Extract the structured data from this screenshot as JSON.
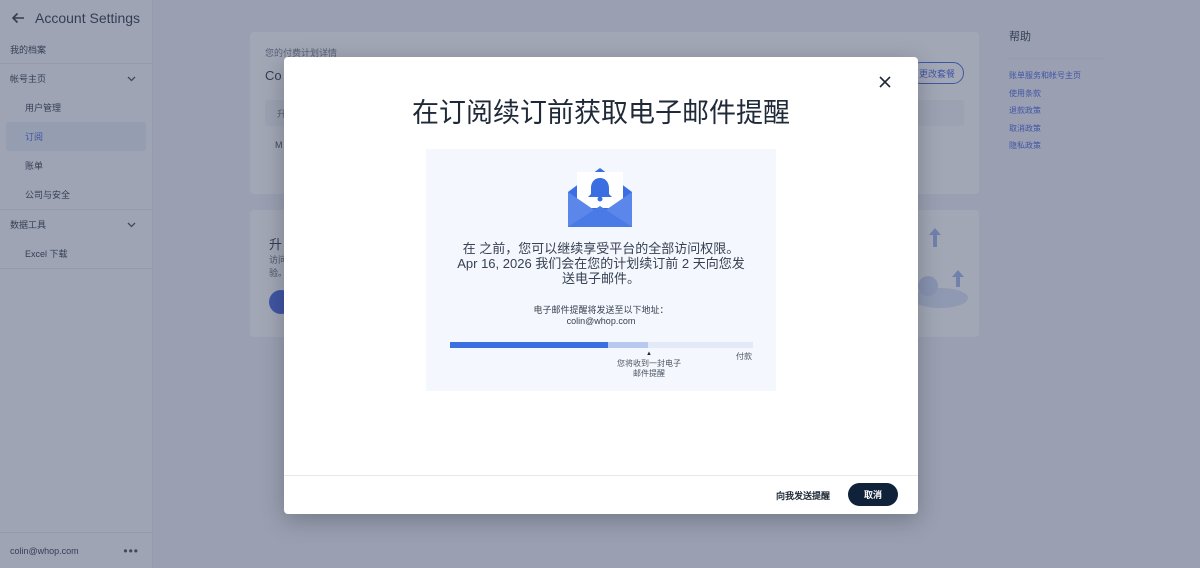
{
  "app": {
    "title": "Account Settings"
  },
  "sidebar": {
    "profile": "我的档案",
    "account_group": "帐号主页",
    "account_items": [
      "用户管理",
      "订阅",
      "账单",
      "公司与安全"
    ],
    "data_group": "数据工具",
    "data_items": [
      "Excel 下载"
    ],
    "user_email": "colin@whop.com"
  },
  "main": {
    "card1_label": "您的付费计划详情",
    "card1_plan": "Co",
    "card1_button": "更改套餐",
    "card1_row": "升",
    "card1_cell": "M",
    "card2_title": "升",
    "card2_text_line1": "访问",
    "card2_text_line2": "验。"
  },
  "help": {
    "title": "帮助",
    "links": [
      "账单服务和帐号主页",
      "使用条款",
      "退款政策",
      "取消政策",
      "隐私政策"
    ]
  },
  "modal": {
    "title": "在订阅续订前获取电子邮件提醒",
    "body_line1": "在 之前，您可以继续享受平台的全部访问权限。",
    "body_line2": "Apr 16, 2026 我们会在您的计划续订前 2 天向您发",
    "body_line3": "送电子邮件。",
    "email_label": "电子邮件提醒将发送至以下地址：",
    "email_value": "colin@whop.com",
    "timeline_progress": 0.52,
    "timeline_mid_label_line1": "您将收到一封电子",
    "timeline_mid_label_line2": "邮件提醒",
    "timeline_end_label": "付款",
    "send_button": "向我发送提醒",
    "cancel_button": "取消"
  },
  "colors": {
    "accent": "#3b5bdb",
    "progress": "#3b6ee0",
    "cancel_bg": "#10213a"
  }
}
